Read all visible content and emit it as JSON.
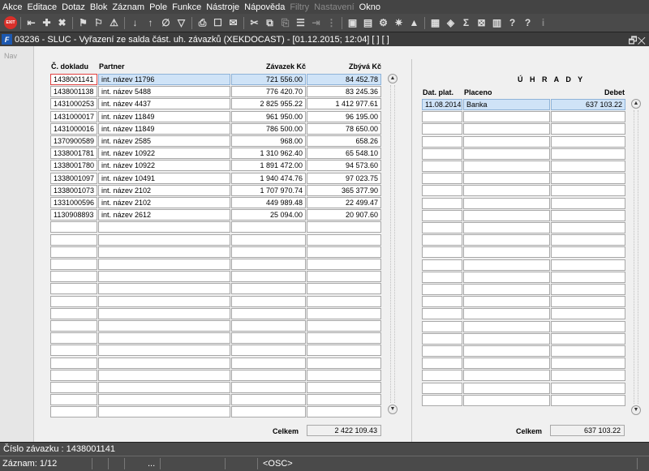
{
  "menu": [
    {
      "label": "Akce",
      "enabled": true
    },
    {
      "label": "Editace",
      "enabled": true
    },
    {
      "label": "Dotaz",
      "enabled": true
    },
    {
      "label": "Blok",
      "enabled": true
    },
    {
      "label": "Záznam",
      "enabled": true
    },
    {
      "label": "Pole",
      "enabled": true
    },
    {
      "label": "Funkce",
      "enabled": true
    },
    {
      "label": "Nástroje",
      "enabled": true
    },
    {
      "label": "Nápověda",
      "enabled": true
    },
    {
      "label": "Filtry",
      "enabled": false
    },
    {
      "label": "Nastavení",
      "enabled": false
    },
    {
      "label": "Okno",
      "enabled": true
    }
  ],
  "toolbar": {
    "exit_label": "EXIT",
    "buttons": [
      {
        "name": "exit-icon",
        "glyph": "EXIT",
        "red": true
      },
      {
        "sep": true
      },
      {
        "name": "first-record-icon",
        "glyph": "⇤"
      },
      {
        "name": "insert-record-icon",
        "glyph": "✚"
      },
      {
        "name": "delete-record-icon",
        "glyph": "✖"
      },
      {
        "sep": true
      },
      {
        "name": "query-icon",
        "glyph": "⚑"
      },
      {
        "name": "query-execute-icon",
        "glyph": "⚐"
      },
      {
        "name": "query-cancel-icon",
        "glyph": "⚠"
      },
      {
        "sep": true
      },
      {
        "name": "sort-asc-icon",
        "glyph": "↓"
      },
      {
        "name": "sort-desc-icon",
        "glyph": "↑"
      },
      {
        "name": "clear-filter-icon",
        "glyph": "∅"
      },
      {
        "name": "filter-icon",
        "glyph": "▽"
      },
      {
        "sep": true
      },
      {
        "name": "print-icon",
        "glyph": "⎙"
      },
      {
        "name": "preview-icon",
        "glyph": "☐"
      },
      {
        "name": "mail-icon",
        "glyph": "✉"
      },
      {
        "sep": true
      },
      {
        "name": "cut-icon",
        "glyph": "✂"
      },
      {
        "name": "copy-icon",
        "glyph": "⧉"
      },
      {
        "name": "paste-icon",
        "glyph": "⎘",
        "disabled": true
      },
      {
        "name": "list-icon",
        "glyph": "☰"
      },
      {
        "name": "indent-icon",
        "glyph": "⇥",
        "disabled": true
      },
      {
        "name": "tree-icon",
        "glyph": "⋮",
        "disabled": true
      },
      {
        "sep": true
      },
      {
        "name": "save-icon",
        "glyph": "▣"
      },
      {
        "name": "document-icon",
        "glyph": "▤"
      },
      {
        "name": "settings-icon",
        "glyph": "⚙"
      },
      {
        "name": "star-icon",
        "glyph": "✷"
      },
      {
        "name": "alert-icon",
        "glyph": "▲"
      },
      {
        "sep": true
      },
      {
        "name": "report-icon",
        "glyph": "▦"
      },
      {
        "name": "lock-icon",
        "glyph": "◈"
      },
      {
        "name": "sum-icon",
        "glyph": "Σ"
      },
      {
        "name": "excel-icon",
        "glyph": "⊠"
      },
      {
        "name": "calc-icon",
        "glyph": "▥"
      },
      {
        "name": "help-user-icon",
        "glyph": "?"
      },
      {
        "name": "help-icon",
        "glyph": "?"
      },
      {
        "name": "info-icon",
        "glyph": "i",
        "disabled": true
      }
    ]
  },
  "window": {
    "title": "03236 - SLUC - Vyřazení ze salda část. uh. závazků (XEKDOCAST) - [01.12.2015; 12:04] [ ] [ ]",
    "app_icon": "F",
    "controls": "🗗✕"
  },
  "nav": {
    "label": "Nav"
  },
  "left_table": {
    "headers": {
      "doc": "Č. dokladu",
      "partner": "Partner",
      "zavazek": "Závazek Kč",
      "zbyva": "Zbývá Kč"
    },
    "rows": [
      {
        "doc": "1438001141",
        "partner": "int. název 11796",
        "zavazek": "721 556.00",
        "zbyva": "84 452.78"
      },
      {
        "doc": "1438001138",
        "partner": "int. název 5488",
        "zavazek": "776 420.70",
        "zbyva": "83 245.36"
      },
      {
        "doc": "1431000253",
        "partner": "int. název 4437",
        "zavazek": "2 825 955.22",
        "zbyva": "1 412 977.61"
      },
      {
        "doc": "1431000017",
        "partner": "int. název 11849",
        "zavazek": "961 950.00",
        "zbyva": "96 195.00"
      },
      {
        "doc": "1431000016",
        "partner": "int. název 11849",
        "zavazek": "786 500.00",
        "zbyva": "78 650.00"
      },
      {
        "doc": "1370900589",
        "partner": "int. název 2585",
        "zavazek": "968.00",
        "zbyva": "658.26"
      },
      {
        "doc": "1338001781",
        "partner": "int. název 10922",
        "zavazek": "1 310 962.40",
        "zbyva": "65 548.10"
      },
      {
        "doc": "1338001780",
        "partner": "int. název 10922",
        "zavazek": "1 891 472.00",
        "zbyva": "94 573.60"
      },
      {
        "doc": "1338001097",
        "partner": "int. název 10491",
        "zavazek": "1 940 474.76",
        "zbyva": "97 023.75"
      },
      {
        "doc": "1338001073",
        "partner": "int. název 2102",
        "zavazek": "1 707 970.74",
        "zbyva": "365 377.90"
      },
      {
        "doc": "1331000596",
        "partner": "int. název 2102",
        "zavazek": "449 989.48",
        "zbyva": "22 499.47"
      },
      {
        "doc": "1130908893",
        "partner": "int. název 2612",
        "zavazek": "25 094.00",
        "zbyva": "20 907.60"
      }
    ],
    "total_label": "Celkem",
    "total_value": "2 422 109.43"
  },
  "right_table": {
    "section_title": "Ú H R A D Y",
    "headers": {
      "date": "Dat. plat.",
      "placeno": "Placeno",
      "debet": "Debet"
    },
    "rows": [
      {
        "date": "11.08.2014",
        "placeno": "Banka",
        "debet": "637 103.22"
      }
    ],
    "total_label": "Celkem",
    "total_value": "637 103.22"
  },
  "status": {
    "line1": "Číslo závazku : 1438001141",
    "record": "Záznam: 1/12",
    "ellipsis": "...",
    "osc": "<OSC>"
  }
}
